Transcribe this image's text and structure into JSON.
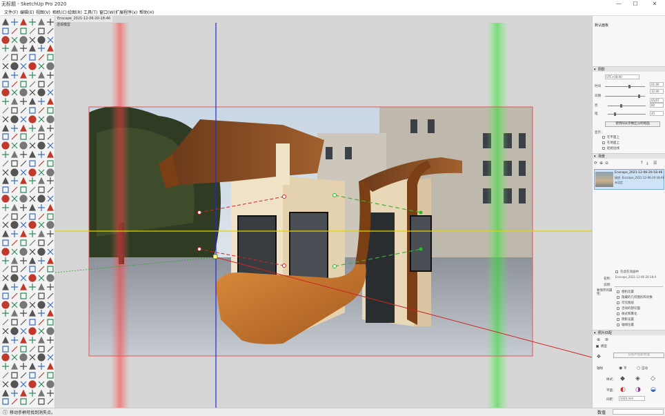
{
  "window": {
    "title": "SketchUp Pro 2020",
    "title_prefix": "无标题 - "
  },
  "window_controls": [
    "—",
    "☐",
    "✕"
  ],
  "menu": [
    "文件(F)",
    "编辑(E)",
    "视图(V)",
    "相机(C)",
    "绘图(R)",
    "工具(T)",
    "窗口(W)",
    "扩展程序(x)",
    "帮助(H)"
  ],
  "scene_tab": "Enscape_2021-12-06-20-18-46",
  "viewport_label": "透视模型",
  "right_panel": {
    "top_label": "默认面板",
    "shadow_section": {
      "title": "阴影",
      "tz": "UTC+08:00",
      "time_label": "时间",
      "time_a": "01:00",
      "time_b": "12:00",
      "date_label": "日期",
      "date_value": "05/07",
      "light_label": "亮",
      "light_value": "80",
      "dark_label": "暗",
      "dark_value": "45",
      "use_sun_btn": "使用阳光参数区分明暗面",
      "display_label": "显示：",
      "options": [
        "在平面上",
        "在地面上",
        "起始边线"
      ]
    },
    "scenes_section": {
      "title": "场景",
      "scene_name": "Enscape_2021-12-06-20-18-46",
      "scene_desc": "描述: Enscape_2021-12-06-20-18-46",
      "scene_sub": "未设定",
      "include_label": "包含在动画中",
      "name_label": "名称：",
      "name_value": "Enscape_2021-12-06-20-18-4",
      "desc_label": "说明：",
      "save_label": "要保存的属性：",
      "props": [
        "相机位置",
        "隐藏的几何图形和对象",
        "可见图层",
        "活动的剖切面",
        "样式和雾化",
        "阴影设置",
        "轴线位置"
      ]
    },
    "matchphoto_section": {
      "title": "照片匹配",
      "model_label": "模型",
      "model_checked": "✓ 模型",
      "from_photo_btn": "从照片投影纹理",
      "axis_label": "轴线",
      "radio_v": "平",
      "radio_auto": "自动",
      "style_label": "样式：",
      "plane_label": "平面：",
      "spacing_label": "间距：",
      "spacing_value": "3324 mm"
    }
  },
  "status": {
    "hint": "移动手柄可找到消失点。",
    "measure_label": "数值"
  }
}
